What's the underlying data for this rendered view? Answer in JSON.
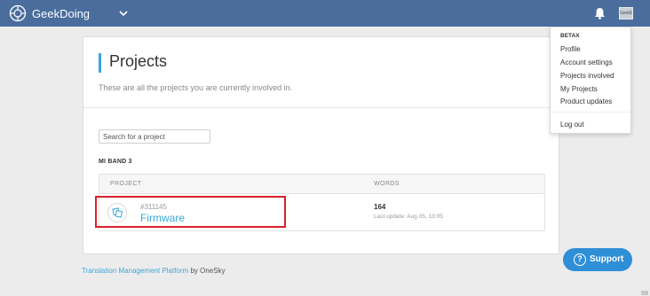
{
  "header": {
    "brand": "GeekDoing",
    "brand_icon": "geekdoing-logo-icon",
    "nav_icon": "chevron-down-icon",
    "notifications_icon": "bell-icon",
    "avatar_text": "GeekDoing"
  },
  "page": {
    "title": "Projects",
    "subtitle": "These are all the projects you are currently involved in."
  },
  "search": {
    "placeholder": "Search for a project"
  },
  "group": {
    "name": "MI BAND 3"
  },
  "table": {
    "headers": {
      "project": "PROJECT",
      "words": "WORDS"
    },
    "rows": [
      {
        "id": "#311145",
        "name": "Firmware",
        "icon": "translate-icon",
        "words": "164",
        "last_update": "Last update: Aug 05, 13:05"
      }
    ]
  },
  "footer": {
    "link_text": "Translation Management Platform",
    "suffix": "by OneSky"
  },
  "support": {
    "label": "Support",
    "icon": "question-circle-icon"
  },
  "dropdown": {
    "header": "BETAX",
    "items": [
      "Profile",
      "Account settings",
      "Projects involved",
      "My Projects",
      "Product updates"
    ],
    "logout": "Log out"
  },
  "colors": {
    "topbar": "#4a6d9e",
    "accent": "#3ba7d9",
    "support": "#2f8fd6",
    "highlight": "#d9202c"
  }
}
